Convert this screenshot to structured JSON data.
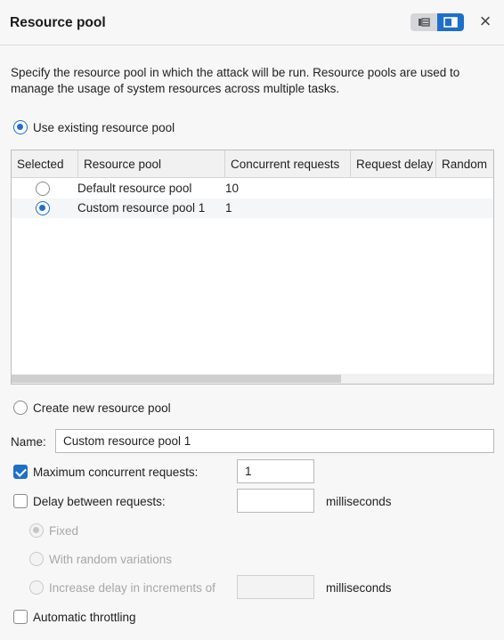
{
  "header": {
    "title": "Resource pool",
    "close_icon": "×"
  },
  "description": "Specify the resource pool in which the attack will be run. Resource pools are used to manage the usage of system resources across multiple tasks.",
  "use_existing": {
    "label": "Use existing resource pool",
    "checked": true
  },
  "table": {
    "columns": [
      "Selected",
      "Resource pool",
      "Concurrent requests",
      "Request delay",
      "Random"
    ],
    "rows": [
      {
        "selected": false,
        "pool": "Default resource pool",
        "concurrent": "10",
        "delay": "",
        "random": ""
      },
      {
        "selected": true,
        "pool": "Custom resource pool 1",
        "concurrent": "1",
        "delay": "",
        "random": ""
      }
    ]
  },
  "create_new": {
    "label": "Create new resource pool",
    "checked": false
  },
  "name_field": {
    "label": "Name:",
    "value": "Custom resource pool 1"
  },
  "max_concurrent": {
    "label": "Maximum concurrent requests:",
    "checked": true,
    "value": "1"
  },
  "delay": {
    "label": "Delay between requests:",
    "checked": false,
    "value": "",
    "unit": "milliseconds"
  },
  "delay_options": {
    "fixed": "Fixed",
    "random": "With random variations",
    "increase": "Increase delay in increments of",
    "increase_value": "",
    "increase_unit": "milliseconds"
  },
  "auto_throttling": {
    "label": "Automatic throttling",
    "checked": false
  },
  "colors": {
    "accent": "#1e6fc9"
  }
}
